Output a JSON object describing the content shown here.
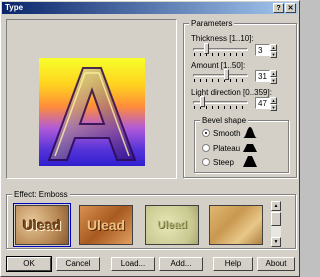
{
  "window": {
    "title": "Type"
  },
  "parameters": {
    "label": "Parameters",
    "thickness": {
      "label": "Thickness [1..10]:",
      "value": "3",
      "level": 0.22
    },
    "amount": {
      "label": "Amount [1..50]:",
      "value": "31",
      "level": 0.61
    },
    "light_direction": {
      "label": "Light direction [0..359]:",
      "value": "47",
      "level": 0.13
    },
    "bevel_shape": {
      "label": "Bevel shape",
      "options": [
        {
          "label": "Smooth",
          "checked": true
        },
        {
          "label": "Plateau",
          "checked": false
        },
        {
          "label": "Steep",
          "checked": false
        }
      ]
    }
  },
  "preview": {
    "letter": "A"
  },
  "effects": {
    "label": "Effect: Emboss",
    "thumbnails": [
      {
        "text": "Ulead",
        "selected": true
      },
      {
        "text": "Ulead",
        "selected": false
      },
      {
        "text": "Ulead",
        "selected": false
      },
      {
        "text": "",
        "selected": false
      }
    ]
  },
  "buttons": {
    "ok": "OK",
    "cancel": "Cancel",
    "load": "Load...",
    "add": "Add...",
    "help": "Help",
    "about": "About"
  }
}
